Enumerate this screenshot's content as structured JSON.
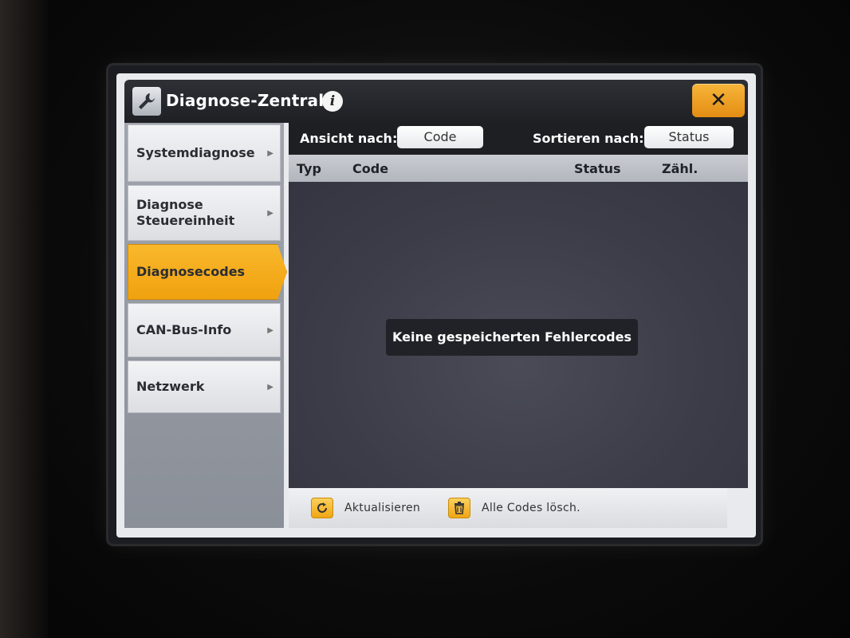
{
  "window": {
    "title": "Diagnose-Zentrale",
    "info_icon": "i",
    "close_icon": "✕"
  },
  "sidebar": {
    "items": [
      {
        "label": "Systemdiagnose",
        "active": false
      },
      {
        "label": "Diagnose Steuereinheit",
        "active": false
      },
      {
        "label": "Diagnosecodes",
        "active": true
      },
      {
        "label": "CAN-Bus-Info",
        "active": false
      },
      {
        "label": "Netzwerk",
        "active": false
      }
    ]
  },
  "toolbar": {
    "view_label": "Ansicht nach:",
    "view_value": "Code",
    "sort_label": "Sortieren nach:",
    "sort_value": "Status"
  },
  "table": {
    "columns": [
      "Typ",
      "Code",
      "Status",
      "Zähl."
    ],
    "empty_message": "Keine gespeicherten Fehlercodes"
  },
  "footer": {
    "refresh_label": "Aktualisieren",
    "clear_label": "Alle Codes lösch."
  },
  "colors": {
    "accent": "#f0a10f",
    "titlebar": "#1e2024",
    "list_background": "#3b3c47"
  }
}
